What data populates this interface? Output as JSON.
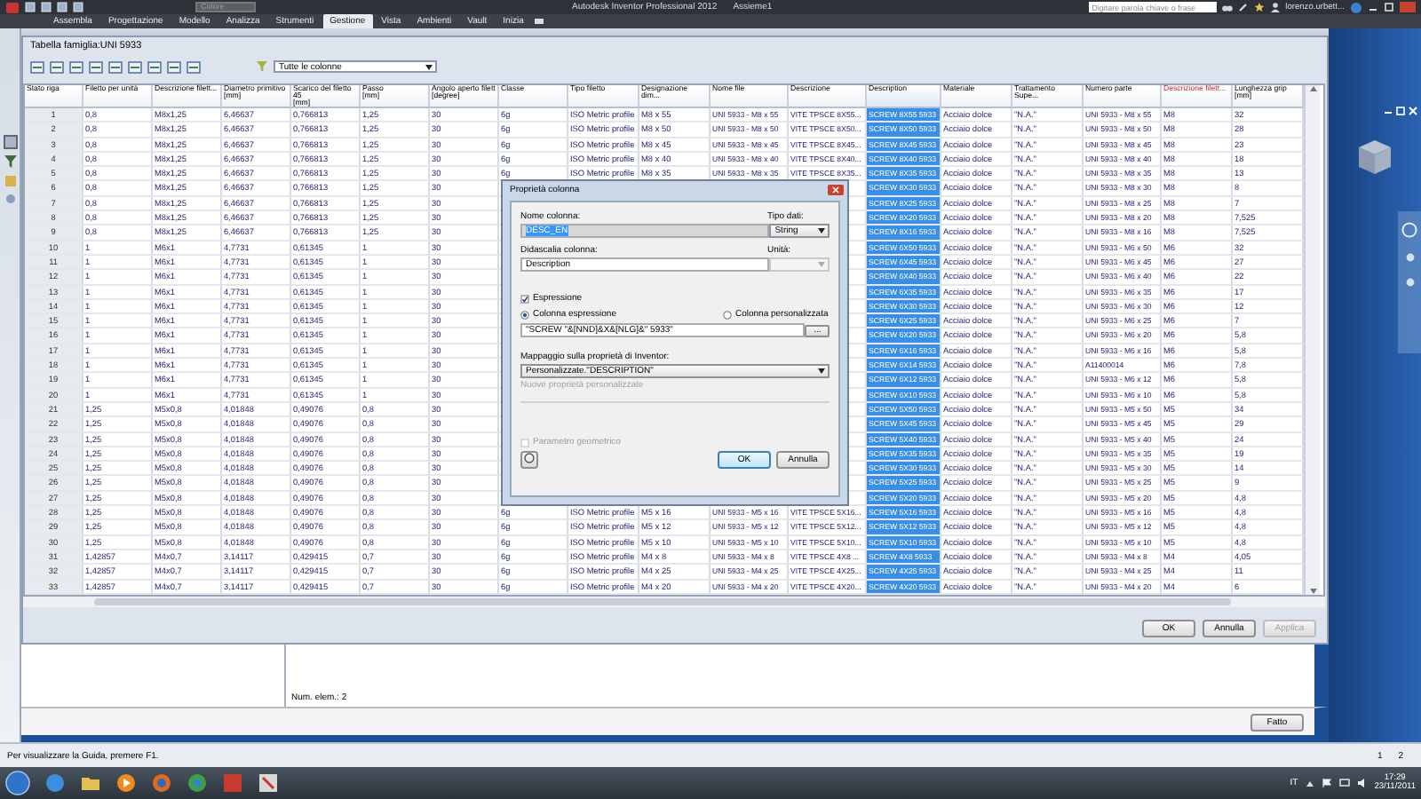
{
  "app": {
    "title": "Autodesk Inventor Professional 2012",
    "document": "Assieme1",
    "quick_combo": {
      "value": "Colore",
      "disabled": true
    },
    "search": {
      "placeholder": "Digitare parola chiave o frase"
    },
    "user": "lorenzo.urbett..."
  },
  "ribbon_tabs": [
    {
      "label": "Assembla",
      "selected": false
    },
    {
      "label": "Progettazione",
      "selected": false
    },
    {
      "label": "Modello",
      "selected": false
    },
    {
      "label": "Analizza",
      "selected": false
    },
    {
      "label": "Strumenti",
      "selected": false
    },
    {
      "label": "Gestione",
      "selected": true
    },
    {
      "label": "Vista",
      "selected": false
    },
    {
      "label": "Ambienti",
      "selected": false
    },
    {
      "label": "Vault",
      "selected": false
    },
    {
      "label": "Inizia",
      "selected": false
    }
  ],
  "family_table": {
    "title": "Tabella famiglia:UNI 5933",
    "filter": {
      "value": "Tutte le colonne"
    },
    "columns": [
      {
        "label": "Stato riga",
        "selected": false,
        "key": false
      },
      {
        "label": "Filetto per unità",
        "selected": false,
        "key": false
      },
      {
        "label": "Descrizione filett...",
        "selected": false,
        "key": false
      },
      {
        "label": "Diametro primitivo",
        "unit": "[mm]",
        "selected": false,
        "key": false
      },
      {
        "label": "Scarico del filetto 45",
        "unit": "[mm]",
        "selected": false,
        "key": false
      },
      {
        "label": "Passo",
        "unit": "[mm]",
        "selected": false,
        "key": false
      },
      {
        "label": "Angolo aperto filett",
        "unit": "[degree]",
        "selected": false,
        "key": false
      },
      {
        "label": "Classe",
        "selected": false,
        "key": false
      },
      {
        "label": "Tipo filetto",
        "selected": false,
        "key": false
      },
      {
        "label": "Designazione dim...",
        "selected": false,
        "key": false
      },
      {
        "label": "Nome file",
        "selected": false,
        "key": false
      },
      {
        "label": "Descrizione",
        "selected": false,
        "key": false
      },
      {
        "label": "Description",
        "selected": true,
        "key": false
      },
      {
        "label": "Materiale",
        "selected": false,
        "key": false
      },
      {
        "label": "Trattamento Supe...",
        "selected": false,
        "key": false
      },
      {
        "label": "Numero parte",
        "selected": false,
        "key": false
      },
      {
        "label": "Descrizione filett...",
        "selected": false,
        "key": true
      },
      {
        "label": "Lunghezza grip",
        "unit": "[mm]",
        "selected": false,
        "key": false
      }
    ],
    "rows": [
      [
        "1",
        "0,8",
        "M8x1,25",
        "6,46637",
        "0,766813",
        "1,25",
        "30",
        "6g",
        "ISO Metric profile",
        "M8 x 55",
        "UNI 5933 - M8 x 55",
        "VITE TPSCE 8X55...",
        "SCREW 8X55 5933",
        "Acciaio dolce",
        "\"N.A.\"",
        "UNI 5933 - M8 x 55",
        "M8",
        "32"
      ],
      [
        "2",
        "0,8",
        "M8x1,25",
        "6,46637",
        "0,766813",
        "1,25",
        "30",
        "6g",
        "ISO Metric profile",
        "M8 x 50",
        "UNI 5933 - M8 x 50",
        "VITE TPSCE 8X50...",
        "SCREW 8X50 5933",
        "Acciaio dolce",
        "\"N.A.\"",
        "UNI 5933 - M8 x 50",
        "M8",
        "28"
      ],
      [
        "3",
        "0,8",
        "M8x1,25",
        "6,46637",
        "0,766813",
        "1,25",
        "30",
        "6g",
        "ISO Metric profile",
        "M8 x 45",
        "UNI 5933 - M8 x 45",
        "VITE TPSCE 8X45...",
        "SCREW 8X45 5933",
        "Acciaio dolce",
        "\"N.A.\"",
        "UNI 5933 - M8 x 45",
        "M8",
        "23"
      ],
      [
        "4",
        "0,8",
        "M8x1,25",
        "6,46637",
        "0,766813",
        "1,25",
        "30",
        "6g",
        "ISO Metric profile",
        "M8 x 40",
        "UNI 5933 - M8 x 40",
        "VITE TPSCE 8X40...",
        "SCREW 8X40 5933",
        "Acciaio dolce",
        "\"N.A.\"",
        "UNI 5933 - M8 x 40",
        "M8",
        "18"
      ],
      [
        "5",
        "0,8",
        "M8x1,25",
        "6,46637",
        "0,766813",
        "1,25",
        "30",
        "6g",
        "ISO Metric profile",
        "M8 x 35",
        "UNI 5933 - M8 x 35",
        "VITE TPSCE 8X35...",
        "SCREW 8X35 5933",
        "Acciaio dolce",
        "\"N.A.\"",
        "UNI 5933 - M8 x 35",
        "M8",
        "13"
      ],
      [
        "6",
        "0,8",
        "M8x1,25",
        "6,46637",
        "0,766813",
        "1,25",
        "30",
        null,
        null,
        null,
        null,
        null,
        "SCREW 8X30 5933",
        "Acciaio dolce",
        "\"N.A.\"",
        "UNI 5933 - M8 x 30",
        "M8",
        "8"
      ],
      [
        "7",
        "0,8",
        "M8x1,25",
        "6,46637",
        "0,766813",
        "1,25",
        "30",
        null,
        null,
        null,
        null,
        null,
        "SCREW 8X25 5933",
        "Acciaio dolce",
        "\"N.A.\"",
        "UNI 5933 - M8 x 25",
        "M8",
        "7"
      ],
      [
        "8",
        "0,8",
        "M8x1,25",
        "6,46637",
        "0,766813",
        "1,25",
        "30",
        null,
        null,
        null,
        null,
        null,
        "SCREW 8X20 5933",
        "Acciaio dolce",
        "\"N.A.\"",
        "UNI 5933 - M8 x 20",
        "M8",
        "7,525"
      ],
      [
        "9",
        "0,8",
        "M8x1,25",
        "6,46637",
        "0,766813",
        "1,25",
        "30",
        null,
        null,
        null,
        null,
        null,
        "SCREW 8X16 5933",
        "Acciaio dolce",
        "\"N.A.\"",
        "UNI 5933 - M8 x 16",
        "M8",
        "7,525"
      ],
      [
        "10",
        "1",
        "M6x1",
        "4,7731",
        "0,61345",
        "1",
        "30",
        null,
        null,
        null,
        null,
        null,
        "SCREW 6X50 5933",
        "Acciaio dolce",
        "\"N.A.\"",
        "UNI 5933 - M6 x 50",
        "M6",
        "32"
      ],
      [
        "11",
        "1",
        "M6x1",
        "4,7731",
        "0,61345",
        "1",
        "30",
        null,
        null,
        null,
        null,
        null,
        "SCREW 6X45 5933",
        "Acciaio dolce",
        "\"N.A.\"",
        "UNI 5933 - M6 x 45",
        "M6",
        "27"
      ],
      [
        "12",
        "1",
        "M6x1",
        "4,7731",
        "0,61345",
        "1",
        "30",
        null,
        null,
        null,
        null,
        null,
        "SCREW 6X40 5933",
        "Acciaio dolce",
        "\"N.A.\"",
        "UNI 5933 - M6 x 40",
        "M6",
        "22"
      ],
      [
        "13",
        "1",
        "M6x1",
        "4,7731",
        "0,61345",
        "1",
        "30",
        null,
        null,
        null,
        null,
        null,
        "SCREW 6X35 5933",
        "Acciaio dolce",
        "\"N.A.\"",
        "UNI 5933 - M6 x 35",
        "M6",
        "17"
      ],
      [
        "14",
        "1",
        "M6x1",
        "4,7731",
        "0,61345",
        "1",
        "30",
        null,
        null,
        null,
        null,
        null,
        "SCREW 6X30 5933",
        "Acciaio dolce",
        "\"N.A.\"",
        "UNI 5933 - M6 x 30",
        "M6",
        "12"
      ],
      [
        "15",
        "1",
        "M6x1",
        "4,7731",
        "0,61345",
        "1",
        "30",
        null,
        null,
        null,
        null,
        null,
        "SCREW 6X25 5933",
        "Acciaio dolce",
        "\"N.A.\"",
        "UNI 5933 - M6 x 25",
        "M6",
        "7"
      ],
      [
        "16",
        "1",
        "M6x1",
        "4,7731",
        "0,61345",
        "1",
        "30",
        null,
        null,
        null,
        null,
        null,
        "SCREW 6X20 5933",
        "Acciaio dolce",
        "\"N.A.\"",
        "UNI 5933 - M6 x 20",
        "M6",
        "5,8"
      ],
      [
        "17",
        "1",
        "M6x1",
        "4,7731",
        "0,61345",
        "1",
        "30",
        null,
        null,
        null,
        null,
        null,
        "SCREW 6X16 5933",
        "Acciaio dolce",
        "\"N.A.\"",
        "UNI 5933 - M6 x 16",
        "M6",
        "5,8"
      ],
      [
        "18",
        "1",
        "M6x1",
        "4,7731",
        "0,61345",
        "1",
        "30",
        null,
        null,
        null,
        null,
        null,
        "SCREW 6X14 5933",
        "Acciaio dolce",
        "\"N.A.\"",
        "A11400014",
        "M6",
        "7,8"
      ],
      [
        "19",
        "1",
        "M6x1",
        "4,7731",
        "0,61345",
        "1",
        "30",
        null,
        null,
        null,
        null,
        null,
        "SCREW 6X12 5933",
        "Acciaio dolce",
        "\"N.A.\"",
        "UNI 5933 - M6 x 12",
        "M6",
        "5,8"
      ],
      [
        "20",
        "1",
        "M6x1",
        "4,7731",
        "0,61345",
        "1",
        "30",
        null,
        null,
        null,
        null,
        null,
        "SCREW 6X10 5933",
        "Acciaio dolce",
        "\"N.A.\"",
        "UNI 5933 - M6 x 10",
        "M6",
        "5,8"
      ],
      [
        "21",
        "1,25",
        "M5x0,8",
        "4,01848",
        "0,49076",
        "0,8",
        "30",
        null,
        null,
        null,
        null,
        null,
        "SCREW 5X50 5933",
        "Acciaio dolce",
        "\"N.A.\"",
        "UNI 5933 - M5 x 50",
        "M5",
        "34"
      ],
      [
        "22",
        "1,25",
        "M5x0,8",
        "4,01848",
        "0,49076",
        "0,8",
        "30",
        null,
        null,
        null,
        null,
        null,
        "SCREW 5X45 5933",
        "Acciaio dolce",
        "\"N.A.\"",
        "UNI 5933 - M5 x 45",
        "M5",
        "29"
      ],
      [
        "23",
        "1,25",
        "M5x0,8",
        "4,01848",
        "0,49076",
        "0,8",
        "30",
        null,
        null,
        null,
        null,
        null,
        "SCREW 5X40 5933",
        "Acciaio dolce",
        "\"N.A.\"",
        "UNI 5933 - M5 x 40",
        "M5",
        "24"
      ],
      [
        "24",
        "1,25",
        "M5x0,8",
        "4,01848",
        "0,49076",
        "0,8",
        "30",
        null,
        null,
        null,
        null,
        null,
        "SCREW 5X35 5933",
        "Acciaio dolce",
        "\"N.A.\"",
        "UNI 5933 - M5 x 35",
        "M5",
        "19"
      ],
      [
        "25",
        "1,25",
        "M5x0,8",
        "4,01848",
        "0,49076",
        "0,8",
        "30",
        null,
        null,
        null,
        null,
        null,
        "SCREW 5X30 5933",
        "Acciaio dolce",
        "\"N.A.\"",
        "UNI 5933 - M5 x 30",
        "M5",
        "14"
      ],
      [
        "26",
        "1,25",
        "M5x0,8",
        "4,01848",
        "0,49076",
        "0,8",
        "30",
        null,
        null,
        null,
        null,
        null,
        "SCREW 5X25 5933",
        "Acciaio dolce",
        "\"N.A.\"",
        "UNI 5933 - M5 x 25",
        "M5",
        "9"
      ],
      [
        "27",
        "1,25",
        "M5x0,8",
        "4,01848",
        "0,49076",
        "0,8",
        "30",
        null,
        null,
        null,
        null,
        null,
        "SCREW 5X20 5933",
        "Acciaio dolce",
        "\"N.A.\"",
        "UNI 5933 - M5 x 20",
        "M5",
        "4,8"
      ],
      [
        "28",
        "1,25",
        "M5x0,8",
        "4,01848",
        "0,49076",
        "0,8",
        "30",
        "6g",
        "ISO Metric profile",
        "M5 x 16",
        "UNI 5933 - M5 x 16",
        "VITE TPSCE 5X16...",
        "SCREW 5X16 5933",
        "Acciaio dolce",
        "\"N.A.\"",
        "UNI 5933 - M5 x 16",
        "M5",
        "4,8"
      ],
      [
        "29",
        "1,25",
        "M5x0,8",
        "4,01848",
        "0,49076",
        "0,8",
        "30",
        "6g",
        "ISO Metric profile",
        "M5 x 12",
        "UNI 5933 - M5 x 12",
        "VITE TPSCE 5X12...",
        "SCREW 5X12 5933",
        "Acciaio dolce",
        "\"N.A.\"",
        "UNI 5933 - M5 x 12",
        "M5",
        "4,8"
      ],
      [
        "30",
        "1,25",
        "M5x0,8",
        "4,01848",
        "0,49076",
        "0,8",
        "30",
        "6g",
        "ISO Metric profile",
        "M5 x 10",
        "UNI 5933 - M5 x 10",
        "VITE TPSCE 5X10...",
        "SCREW 5X10 5933",
        "Acciaio dolce",
        "\"N.A.\"",
        "UNI 5933 - M5 x 10",
        "M5",
        "4,8"
      ],
      [
        "31",
        "1,42857",
        "M4x0,7",
        "3,14117",
        "0,429415",
        "0,7",
        "30",
        "6g",
        "ISO Metric profile",
        "M4 x 8",
        "UNI 5933 - M4 x 8",
        "VITE TPSCE 4X8 ...",
        "SCREW 4X8 5933",
        "Acciaio dolce",
        "\"N.A.\"",
        "UNI 5933 - M4 x 8",
        "M4",
        "4,05"
      ],
      [
        "32",
        "1,42857",
        "M4x0,7",
        "3,14117",
        "0,429415",
        "0,7",
        "30",
        "6g",
        "ISO Metric profile",
        "M4 x 25",
        "UNI 5933 - M4 x 25",
        "VITE TPSCE 4X25...",
        "SCREW 4X25 5933",
        "Acciaio dolce",
        "\"N.A.\"",
        "UNI 5933 - M4 x 25",
        "M4",
        "11"
      ],
      [
        "33",
        "1,42857",
        "M4x0,7",
        "3,14117",
        "0,429415",
        "0,7",
        "30",
        "6g",
        "ISO Metric profile",
        "M4 x 20",
        "UNI 5933 - M4 x 20",
        "VITE TPSCE 4X20...",
        "SCREW 4X20 5933",
        "Acciaio dolce",
        "\"N.A.\"",
        "UNI 5933 - M4 x 20",
        "M4",
        "6"
      ]
    ],
    "buttons": [
      {
        "label": "OK",
        "disabled": false
      },
      {
        "label": "Annulla",
        "disabled": false
      },
      {
        "label": "Applica",
        "disabled": true
      }
    ]
  },
  "column_dialog": {
    "title": "Proprietà colonna",
    "name_label": "Nome colonna:",
    "name_value": "DESC_EN",
    "type_label": "Tipo dati:",
    "type_value": "String",
    "caption_label": "Didascalia colonna:",
    "caption_value": "Description",
    "unit_label": "Unità:",
    "unit_field": {
      "disabled": true
    },
    "expression": {
      "label": "Espressione",
      "checked": true
    },
    "radios": [
      {
        "label": "Colonna espressione",
        "selected": true
      },
      {
        "label": "Colonna personalizzata",
        "selected": false
      }
    ],
    "expression_value": "\"SCREW \"&[NND]&X&[NLG]&\" 5933\"",
    "browse_button": "...",
    "mapping_label": "Mappaggio sulla proprietà di Inventor:",
    "mapping_value": "Personalizzate.\"DESCRIPTION\"",
    "new_property": {
      "label": "Nuove proprietà personalizzate",
      "disabled": true
    },
    "geometric": {
      "label": "Parametro geometrico",
      "checked": false,
      "disabled": true
    },
    "buttons": [
      {
        "label": "OK",
        "default": true
      },
      {
        "label": "Annulla",
        "default": false
      }
    ]
  },
  "browser_panel": {
    "count": "Num. elem.: 2",
    "done_button": "Fatto"
  },
  "status_bar": {
    "text": "Per visualizzare la Guida, premere F1.",
    "pages": [
      "1",
      "2"
    ]
  },
  "taskbar": {
    "language": "IT",
    "time": "17:29",
    "date": "23/11/2011"
  }
}
